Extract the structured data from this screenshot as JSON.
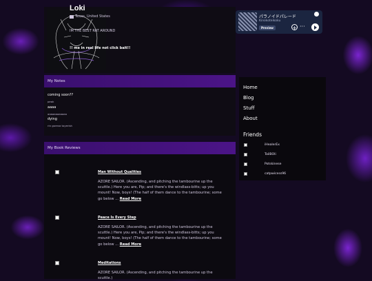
{
  "profile": {
    "name": "Loki",
    "location": "Texas, United States",
    "bio_line1": "IM THE BEST RAT AROUND",
    "bio_line2": "!! me in real life not click bait!!"
  },
  "spotify": {
    "track": "パラノイドパレード",
    "artist": "Kinokoteikoku",
    "preview_label": "Preview",
    "add_symbol": "+",
    "more_symbol": "···"
  },
  "notes": {
    "header": "My Notes",
    "items": [
      {
        "title": "coming soon??",
        "body": "peak"
      },
      {
        "title": "aaaa",
        "body": "aaaaaaaaaaaa"
      },
      {
        "title": "dying",
        "body": "rin goreva toyerish"
      }
    ]
  },
  "reviews": {
    "header": "My Book Reviews",
    "read_more": "Read More",
    "items": [
      {
        "title": "Man Without Qualities",
        "excerpt": "AZORE SAILOR. (Ascending, and pitching the tambourine up the scuttle.) Here you are, Pip; and there's the windlass-bitts; up you mount! Now, boys! (The half of them dance to the tambourine; some go below ..."
      },
      {
        "title": "Peace Is Every Step",
        "excerpt": "AZORE SAILOR. (Ascending, and pitching the tambourine up the scuttle.) Here you are, Pip; and there's the windlass-bitts; up you mount! Now, boys! (The half of them dance to the tambourine; some go below ..."
      },
      {
        "title": "Meditations",
        "excerpt": "AZORE SAILOR. (Ascending, and pitching the tambourine up the scuttle.)"
      }
    ]
  },
  "nav": {
    "items": [
      "Home",
      "Blog",
      "Stuff",
      "About"
    ]
  },
  "friends": {
    "title": "Friends",
    "items": [
      "iHealerEx",
      "TailBOIi",
      "Potskinese",
      "catpwicess96"
    ]
  }
}
